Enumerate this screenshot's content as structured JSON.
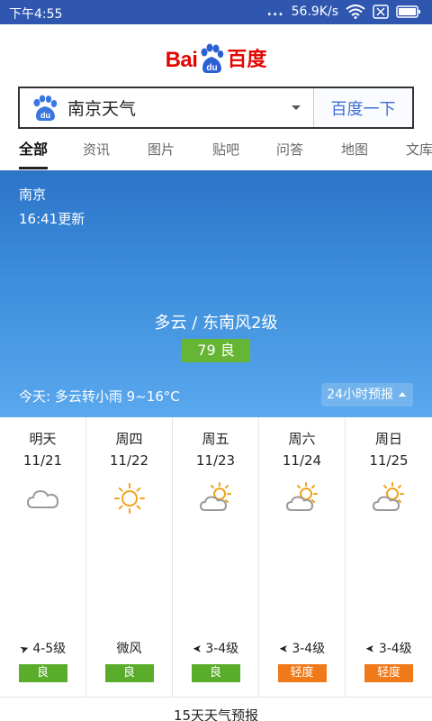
{
  "status_bar": {
    "time": "下午4:55",
    "dots": "...",
    "network_speed": "56.9K/s",
    "icons": [
      "wifi-icon",
      "sim-x-icon",
      "battery-icon"
    ]
  },
  "logo": {
    "latin_bai": "Bai",
    "du": "du",
    "chinese": "百度"
  },
  "search": {
    "query": "南京天气",
    "button_label": "百度一下"
  },
  "tabs": [
    {
      "label": "全部",
      "active": true
    },
    {
      "label": "资讯"
    },
    {
      "label": "图片"
    },
    {
      "label": "贴吧"
    },
    {
      "label": "问答"
    },
    {
      "label": "地图"
    },
    {
      "label": "文库"
    }
  ],
  "weather": {
    "city": "南京",
    "updated": "16:41更新",
    "condition": "多云 / 东南风2级",
    "aqi": "79 良",
    "today": "今天: 多云转小雨 9~16°C",
    "hourly_button": "24小时预报"
  },
  "forecast": [
    {
      "name": "明天",
      "date": "11/21",
      "icon": "cloudy-icon",
      "wind": "4-5级",
      "wind_arrow": true,
      "aqi": "良",
      "aqi_color": "#5aad2b"
    },
    {
      "name": "周四",
      "date": "11/22",
      "icon": "sunny-icon",
      "wind": "微风",
      "wind_arrow": false,
      "aqi": "良",
      "aqi_color": "#5aad2b"
    },
    {
      "name": "周五",
      "date": "11/23",
      "icon": "partly-cloudy-icon",
      "wind": "3-4级",
      "wind_arrow": true,
      "aqi": "良",
      "aqi_color": "#5aad2b"
    },
    {
      "name": "周六",
      "date": "11/24",
      "icon": "partly-cloudy-icon",
      "wind": "3-4级",
      "wind_arrow": true,
      "aqi": "轻度",
      "aqi_color": "#f07a1a"
    },
    {
      "name": "周日",
      "date": "11/25",
      "icon": "partly-cloudy-icon",
      "wind": "3-4级",
      "wind_arrow": true,
      "aqi": "轻度",
      "aqi_color": "#f07a1a"
    }
  ],
  "more_link": "15天天气预报",
  "colors": {
    "status_bar": "#2f57b0",
    "brand_red": "#e10602",
    "brand_blue": "#3f6fd4",
    "aqi_good": "#5aad2b",
    "aqi_light": "#f07a1a"
  }
}
